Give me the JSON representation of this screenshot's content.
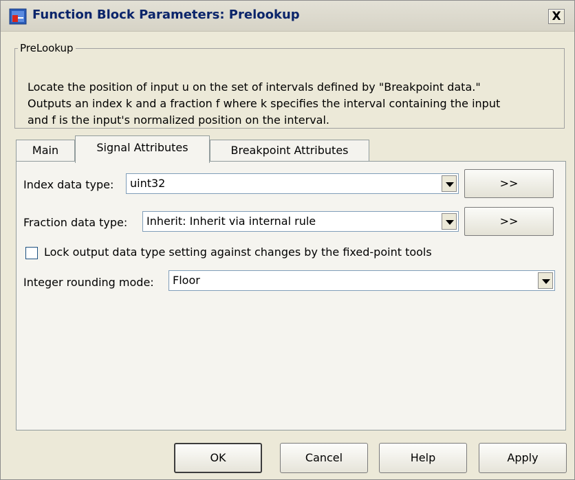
{
  "window": {
    "title": "Function Block Parameters: Prelookup",
    "close_label": "X"
  },
  "group": {
    "legend": "PreLookup",
    "description_lines": [
      "Locate the position of input u on the set of intervals defined by \"Breakpoint data.\"",
      "Outputs an index k and a fraction f where k specifies the interval containing the input",
      "and f is the input's normalized position on the interval."
    ]
  },
  "tabs": [
    {
      "label": "Main",
      "active": false
    },
    {
      "label": "Signal Attributes",
      "active": true
    },
    {
      "label": "Breakpoint Attributes",
      "active": false
    }
  ],
  "signal": {
    "index_label": "Index data type:",
    "index_value": "uint32",
    "index_assist": ">>",
    "fraction_label": "Fraction data type:",
    "fraction_value": "Inherit: Inherit via internal rule",
    "fraction_assist": ">>",
    "lock_label": "Lock output data type setting against changes by the fixed-point tools",
    "lock_checked": false,
    "rounding_label": "Integer rounding mode:",
    "rounding_value": "Floor"
  },
  "buttons": {
    "ok": "OK",
    "cancel": "Cancel",
    "help": "Help",
    "apply": "Apply"
  }
}
